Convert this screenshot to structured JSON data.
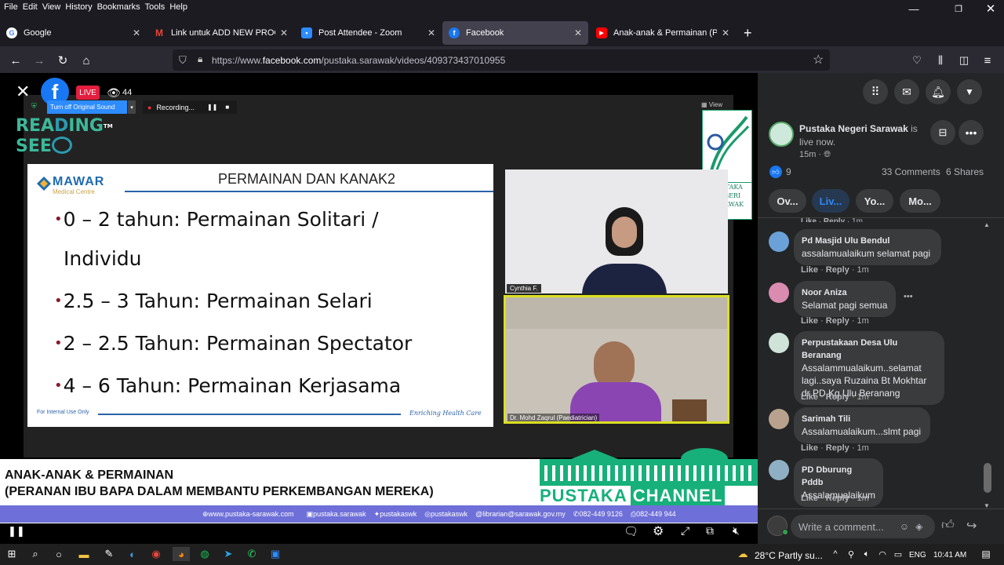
{
  "menu": [
    "File",
    "Edit",
    "View",
    "History",
    "Bookmarks",
    "Tools",
    "Help"
  ],
  "tabs": [
    {
      "title": "Google",
      "icon": "google-icon",
      "color": "#4285f4",
      "letter": "G"
    },
    {
      "title": "Link untuk ADD NEW PROGRAM",
      "icon": "gmail-icon",
      "color": "#d93025",
      "letter": "M"
    },
    {
      "title": "Post Attendee - Zoom",
      "icon": "zoom-icon",
      "color": "#2d8cff",
      "letter": "z"
    },
    {
      "title": "Facebook",
      "icon": "facebook-icon",
      "color": "#1877f2",
      "letter": "f"
    },
    {
      "title": "Anak-anak & Permainan (Peran",
      "icon": "youtube-icon",
      "color": "#ff0000",
      "letter": "▶"
    }
  ],
  "url_prefix": "https://www.",
  "url_domain": "facebook.com",
  "url_rest": "/pustaka.sarawak/videos/409373437010955",
  "video": {
    "live_label": "LIVE",
    "viewers": "44",
    "sound_btn": "Turn off Original Sound",
    "recording": "Recording...",
    "view_label": "View",
    "brand1": "REA",
    "brand2": "ING",
    "brand3": "SEE",
    "brand_tm": "TM",
    "pustaka_logo": [
      "PUSTAKA",
      "NEGERI",
      "SARAWAK"
    ]
  },
  "slide": {
    "logo_name": "MAWAR",
    "logo_sub": "Medical Centre",
    "title": "PERMAINAN DAN KANAK2",
    "bullets": [
      "0 – 2 tahun: Permainan Solitari /",
      "Individu",
      "2.5 – 3 Tahun: Permainan Selari",
      "2 – 2.5 Tahun: Permainan Spectator",
      "4 – 6 Tahun: Permainan Kerjasama"
    ],
    "footer_left": "For Internal Use Only",
    "footer_right": "Enriching Health Care"
  },
  "participants": {
    "p1": "Cynthia F.",
    "p2": "Dr. Mohd Zaqrul (Paediatrician)"
  },
  "banner": {
    "line1": "ANAK-ANAK & PERMAINAN",
    "line2": "(PERANAN IBU BAPA DALAM  MEMBANTU PERKEMBANGAN MEREKA)",
    "channel_a": "PUSTAKA",
    "channel_b": "CHANNEL",
    "contacts": [
      "www.pustaka-sarawak.com",
      "pustaka.sarawak",
      "pustakaswk",
      "pustakaswk",
      "librarian@sarawak.gov.my",
      "082-449 9126",
      "082-449 944"
    ]
  },
  "panel": {
    "page_name": "Pustaka Negeri Sarawak",
    "is_text": "is",
    "live_now": "live now.",
    "time": "15m",
    "reactions": "9",
    "comments_count": "33 Comments",
    "shares": "6 Shares",
    "chips": [
      "Ov...",
      "Liv...",
      "Yo...",
      "Mo..."
    ],
    "like": "Like",
    "reply": "Reply",
    "write_placeholder": "Write a comment...",
    "comments": [
      {
        "name": "Pd Masjid Ulu Bendul",
        "text": "assalamualaikum selamat pagi",
        "time": "1m"
      },
      {
        "name": "Noor Aniza",
        "text": "Selamat pagi semua",
        "time": "1m"
      },
      {
        "name": "Perpustakaan Desa Ulu Beranang",
        "text": "Assalammualaikum..selamat lagi..saya Ruzaina Bt Mokhtar dr PD Kg Ulu Beranang",
        "time": "1m"
      },
      {
        "name": "Sarimah Tili",
        "text": "Assalamualaikum...slmt pagi",
        "time": "1m"
      },
      {
        "name": "PD Dburung Pddb",
        "text": "Assalamualaikum",
        "time": "1m"
      }
    ]
  },
  "taskbar": {
    "weather": "28°C  Partly su...",
    "lang": "ENG",
    "clock": "10:41 AM"
  }
}
